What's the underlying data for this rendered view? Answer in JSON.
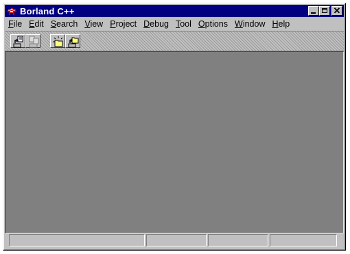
{
  "window": {
    "title": "Borland C++",
    "app_icon": "borland-bull-icon"
  },
  "title_buttons": [
    "minimize-icon",
    "maximize-icon",
    "close-icon"
  ],
  "menu": [
    {
      "label": "File",
      "mnemonic": "F"
    },
    {
      "label": "Edit",
      "mnemonic": "E"
    },
    {
      "label": "Search",
      "mnemonic": "S"
    },
    {
      "label": "View",
      "mnemonic": "V"
    },
    {
      "label": "Project",
      "mnemonic": "P"
    },
    {
      "label": "Debug",
      "mnemonic": "D"
    },
    {
      "label": "Tool",
      "mnemonic": "T"
    },
    {
      "label": "Options",
      "mnemonic": "O"
    },
    {
      "label": "Window",
      "mnemonic": "W"
    },
    {
      "label": "Help",
      "mnemonic": "H"
    }
  ],
  "toolbar": {
    "buttons": [
      "open-file-icon",
      "save-file-icon",
      "new-project-icon",
      "open-project-icon"
    ]
  },
  "colors": {
    "titlebar": "#000080",
    "face": "#c0c0c0",
    "client": "#808080"
  }
}
